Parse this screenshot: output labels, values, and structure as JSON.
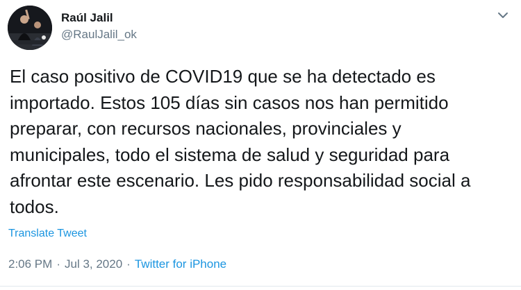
{
  "author": {
    "display_name": "Raúl Jalil",
    "handle": "@RaulJalil_ok"
  },
  "tweet": {
    "text": "El caso positivo de COVID19 que se ha detectado es\nimportado. Estos 105 días sin casos nos han permitido\npreparar, con recursos nacionales, provinciales y\nmunicipales, todo el sistema de salud y seguridad para\nafrontar este escenario. Les pido responsabilidad social a\ntodos.",
    "translate_label": "Translate Tweet",
    "time": "2:06 PM",
    "date": "Jul 3, 2020",
    "source": "Twitter for iPhone",
    "separator": "·"
  },
  "icons": {
    "avatar": "profile-photo",
    "more": "chevron-down-icon"
  },
  "colors": {
    "text": "#14171a",
    "secondary": "#657786",
    "link": "#1b95e0",
    "divider": "#e1e8ed"
  }
}
